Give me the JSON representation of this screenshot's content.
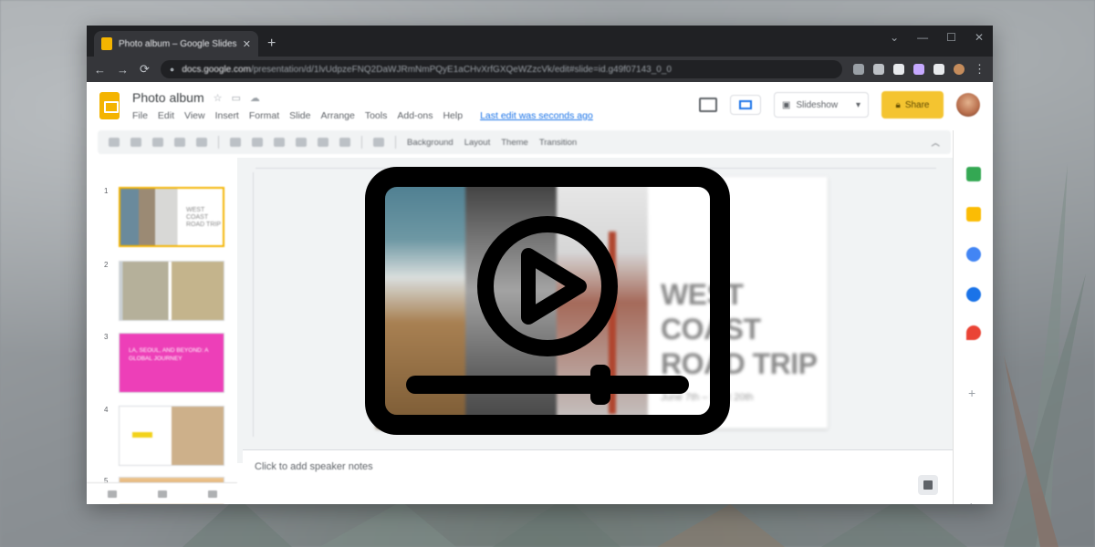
{
  "browser": {
    "tab_title": "Photo album – Google Slides",
    "tab_close": "✕",
    "new_tab": "+",
    "window_controls": [
      "⌄",
      "—",
      "☐",
      "✕"
    ],
    "url_domain": "docs.google.com",
    "url_path": "/presentation/d/1lvUdpzeFNQ2DaWJRmNmPQyE1aCHvXrfGXQeWZzcVk/edit#slide=id.g49f07143_0_0"
  },
  "app": {
    "doc_title": "Photo album",
    "menu": [
      "File",
      "Edit",
      "View",
      "Insert",
      "Format",
      "Slide",
      "Arrange",
      "Tools",
      "Add-ons",
      "Help"
    ],
    "last_edit": "Last edit was seconds ago",
    "slideshow_label": "Slideshow",
    "share_label": "Share"
  },
  "toolbar": {
    "items": [
      "Background",
      "Layout",
      "Theme",
      "Transition"
    ]
  },
  "filmstrip": {
    "numbers": [
      "1",
      "2",
      "3",
      "4",
      "5"
    ],
    "thumb1_text": "WEST COAST ROAD TRIP",
    "thumb3_text": "LA, SEOUL, AND BEYOND: A GLOBAL JOURNEY"
  },
  "slide": {
    "title_line1": "WEST COAST",
    "title_line2": "ROAD TRIP",
    "subtitle": "June 7th – Sept 20th"
  },
  "notes": {
    "placeholder": "Click to add speaker notes"
  },
  "colors": {
    "slides_yellow": "#f4b400",
    "share_button": "#f4c430",
    "pink_slide": "#ed3fb8",
    "overlay_icon": "#000000"
  },
  "overlay": {
    "icon": "video-player-icon"
  }
}
